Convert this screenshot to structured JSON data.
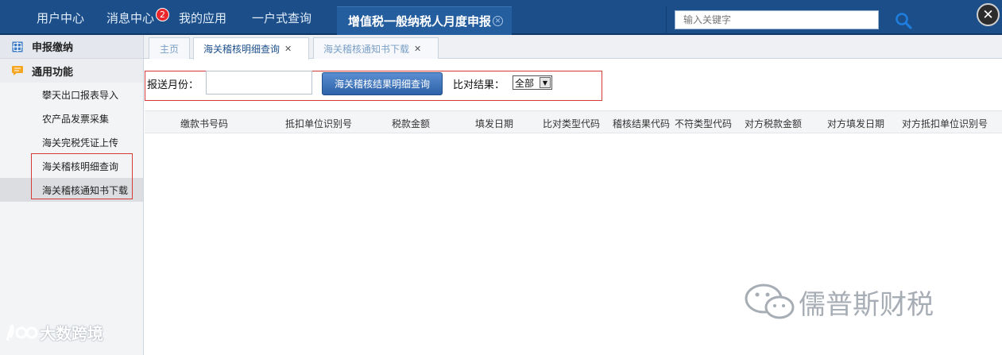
{
  "topbar": {
    "nav": [
      "用户中心",
      "消息中心",
      "我的应用",
      "一户式查询"
    ],
    "message_badge": "2",
    "active_tab": "增值税一般纳税人月度申报",
    "search_placeholder": "输入关键字"
  },
  "sidebar": {
    "sections": [
      "申报缴纳",
      "通用功能"
    ],
    "items": [
      "攀天出口报表导入",
      "农产品发票采集",
      "海关完税凭证上传",
      "海关稽核明细查询",
      "海关稽核通知书下载"
    ]
  },
  "tabs": [
    "主页",
    "海关稽核明细查询",
    "海关稽核通知书下载"
  ],
  "query": {
    "month_label": "报送月份：",
    "month_value": "",
    "search_button": "海关稽核结果明细查询",
    "result_label": "比对结果：",
    "result_selected": "全部"
  },
  "table": {
    "columns": [
      "缴款书号码",
      "抵扣单位识别号",
      "税款金额",
      "填发日期",
      "比对类型代码",
      "稽核结果代码",
      "不符类型代码",
      "对方税款金额",
      "对方填发日期",
      "对方抵扣单位识别号"
    ]
  },
  "watermarks": {
    "left": "大数跨境",
    "right": "儒普斯财税"
  }
}
